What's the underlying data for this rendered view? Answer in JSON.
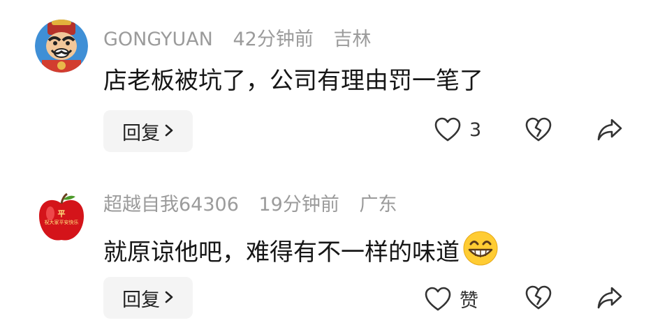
{
  "comments": [
    {
      "username": "GONGYUAN",
      "time": "42分钟前",
      "location": "吉林",
      "text": "店老板被坑了，公司有理由罚一笔了",
      "reply_label": "回复",
      "like_label": "3",
      "avatar_icon": "cartoon-god-of-wealth-avatar"
    },
    {
      "username": "超越自我64306",
      "time": "19分钟前",
      "location": "广东",
      "text": "就原谅他吧，难得有不一样的味道",
      "emoji": "grinning-face-emoji",
      "reply_label": "回复",
      "like_label": "赞",
      "avatar_icon": "red-apple-avatar",
      "avatar_text": [
        "平",
        "祝大家平安快乐"
      ]
    }
  ],
  "icons": {
    "like": "heart-outline-icon",
    "dislike": "broken-heart-icon",
    "share": "share-arrow-icon",
    "reply_chevron": "chevron-right-icon"
  }
}
